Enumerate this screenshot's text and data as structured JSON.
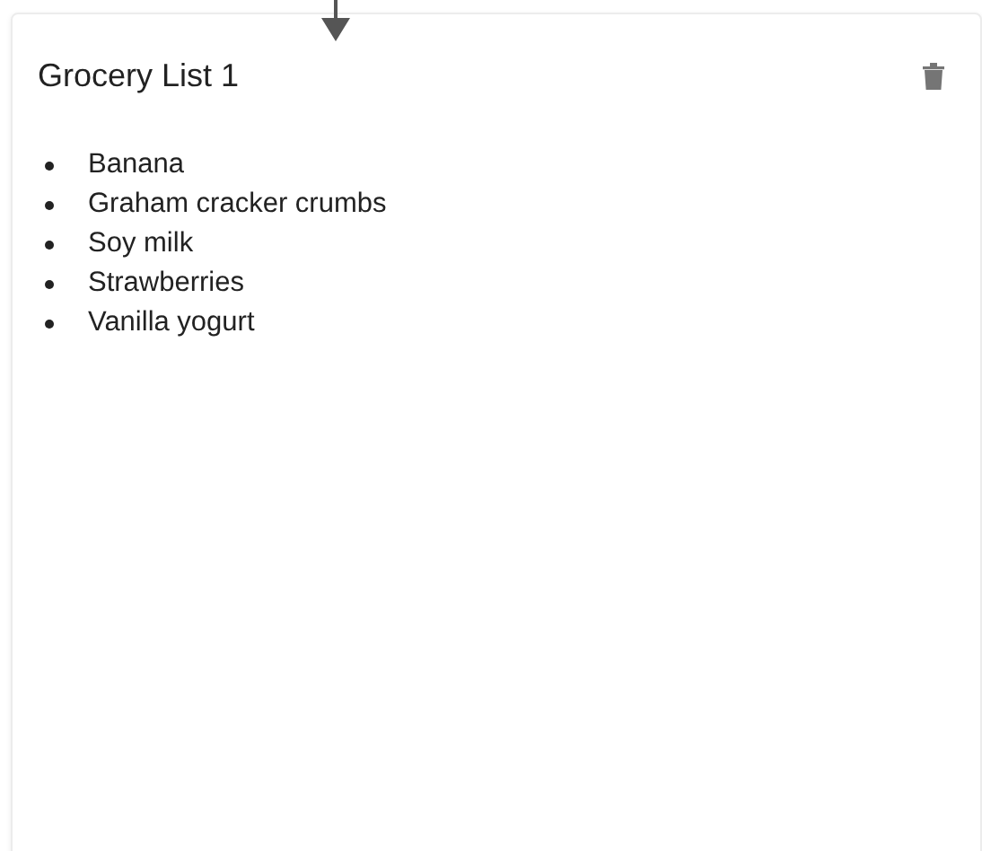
{
  "card": {
    "title": "Grocery List 1",
    "items": [
      "Banana",
      "Graham cracker crumbs",
      "Soy milk",
      "Strawberries",
      "Vanilla yogurt"
    ]
  }
}
